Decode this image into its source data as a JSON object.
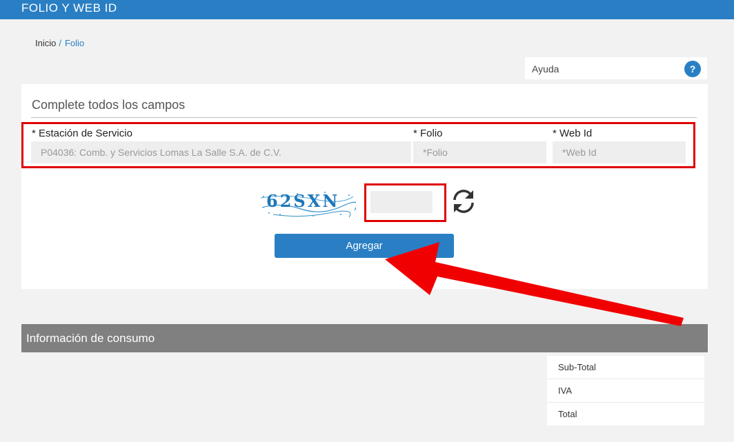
{
  "header": {
    "title": "FOLIO Y WEB ID"
  },
  "breadcrumb": {
    "home": "Inicio",
    "separator": "/",
    "current": "Folio"
  },
  "help": {
    "label": "Ayuda",
    "icon_glyph": "?"
  },
  "form": {
    "heading": "Complete todos los campos",
    "station": {
      "label": "* Estación de Servicio",
      "value": "P04036: Comb. y Servicios Lomas La Salle S.A. de C.V."
    },
    "folio": {
      "label": "* Folio",
      "placeholder": "*Folio"
    },
    "webid": {
      "label": "* Web Id",
      "placeholder": "*Web Id"
    },
    "captcha": {
      "text": "62SXN",
      "value": ""
    },
    "submit_label": "Agregar"
  },
  "consumo": {
    "title": "Información de consumo",
    "rows": [
      "Sub-Total",
      "IVA",
      "Total"
    ]
  },
  "colors": {
    "primary": "#2a7fc4",
    "highlight": "#e00000",
    "section_bar": "#808080"
  },
  "icons": {
    "refresh": "refresh-icon",
    "help": "help-icon",
    "arrow": "red-arrow-annotation"
  }
}
